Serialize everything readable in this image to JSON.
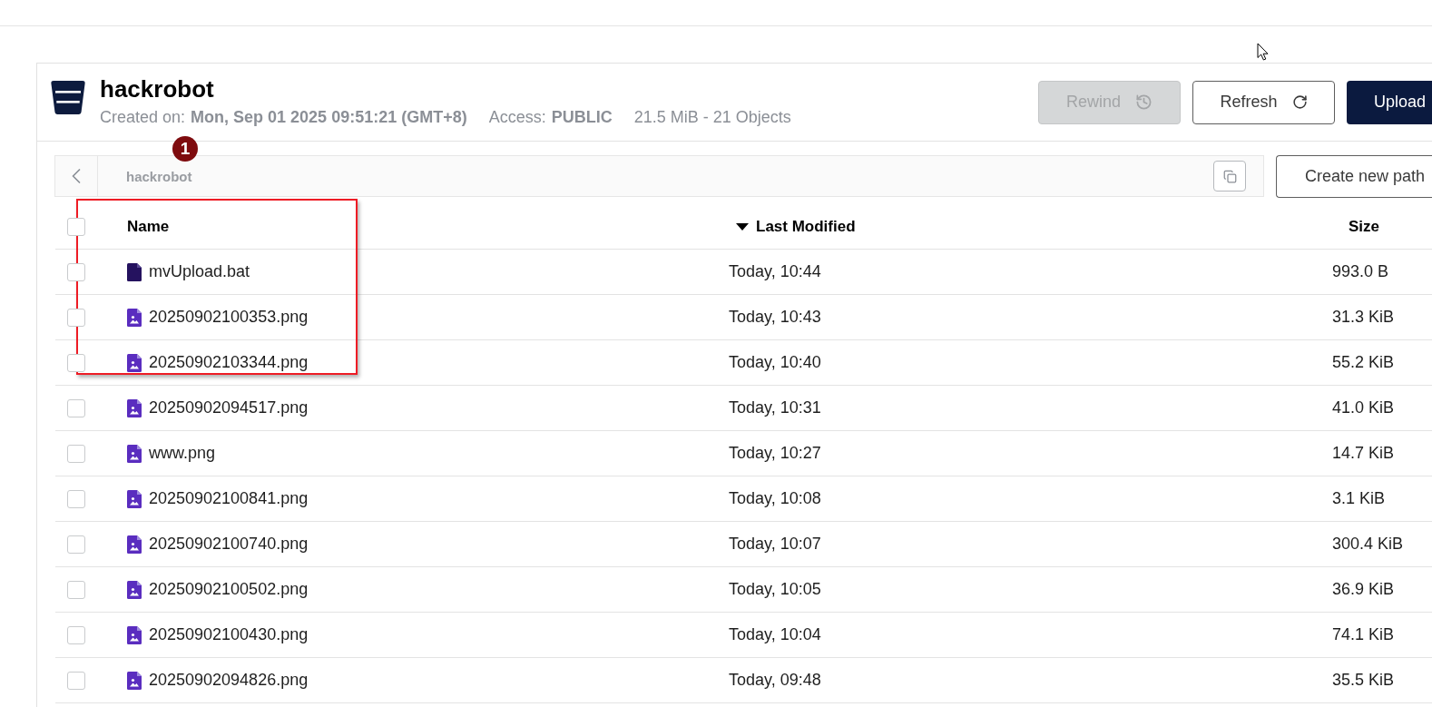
{
  "bucket": {
    "name": "hackrobot",
    "meta": [
      {
        "label": "Created on:",
        "value": "Mon, Sep 01 2025 09:51:21 (GMT+8)"
      },
      {
        "label": "Access:",
        "value": "PUBLIC"
      }
    ],
    "usage": "21.5 MiB - 21 Objects"
  },
  "actions": [
    {
      "label": "Rewind",
      "kind": "rewind",
      "disabled": true
    },
    {
      "label": "Refresh",
      "kind": "refresh",
      "disabled": false
    },
    {
      "label": "Upload",
      "kind": "upload",
      "disabled": false
    }
  ],
  "path_bar": {
    "path": "hackrobot",
    "create_button": "Create new path"
  },
  "table": {
    "select_all": {
      "checked": false
    },
    "columns": [
      {
        "label": "Name",
        "sorted": false
      },
      {
        "label": "Last Modified",
        "sorted": true
      },
      {
        "label": "Size",
        "sorted": false
      }
    ],
    "rows": [
      {
        "name": "mvUpload.bat",
        "kind": "file",
        "modified": "Today, 10:44",
        "size": "993.0 B",
        "checked": false
      },
      {
        "name": "20250902100353.png",
        "kind": "image",
        "modified": "Today, 10:43",
        "size": "31.3 KiB",
        "checked": false
      },
      {
        "name": "20250902103344.png",
        "kind": "image",
        "modified": "Today, 10:40",
        "size": "55.2 KiB",
        "checked": false
      },
      {
        "name": "20250902094517.png",
        "kind": "image",
        "modified": "Today, 10:31",
        "size": "41.0 KiB",
        "checked": false
      },
      {
        "name": "www.png",
        "kind": "image",
        "modified": "Today, 10:27",
        "size": "14.7 KiB",
        "checked": false
      },
      {
        "name": "20250902100841.png",
        "kind": "image",
        "modified": "Today, 10:08",
        "size": "3.1 KiB",
        "checked": false
      },
      {
        "name": "20250902100740.png",
        "kind": "image",
        "modified": "Today, 10:07",
        "size": "300.4 KiB",
        "checked": false
      },
      {
        "name": "20250902100502.png",
        "kind": "image",
        "modified": "Today, 10:05",
        "size": "36.9 KiB",
        "checked": false
      },
      {
        "name": "20250902100430.png",
        "kind": "image",
        "modified": "Today, 10:04",
        "size": "74.1 KiB",
        "checked": false
      },
      {
        "name": "20250902094826.png",
        "kind": "image",
        "modified": "Today, 09:48",
        "size": "35.5 KiB",
        "checked": false
      }
    ]
  },
  "annotation": {
    "number": "1"
  }
}
